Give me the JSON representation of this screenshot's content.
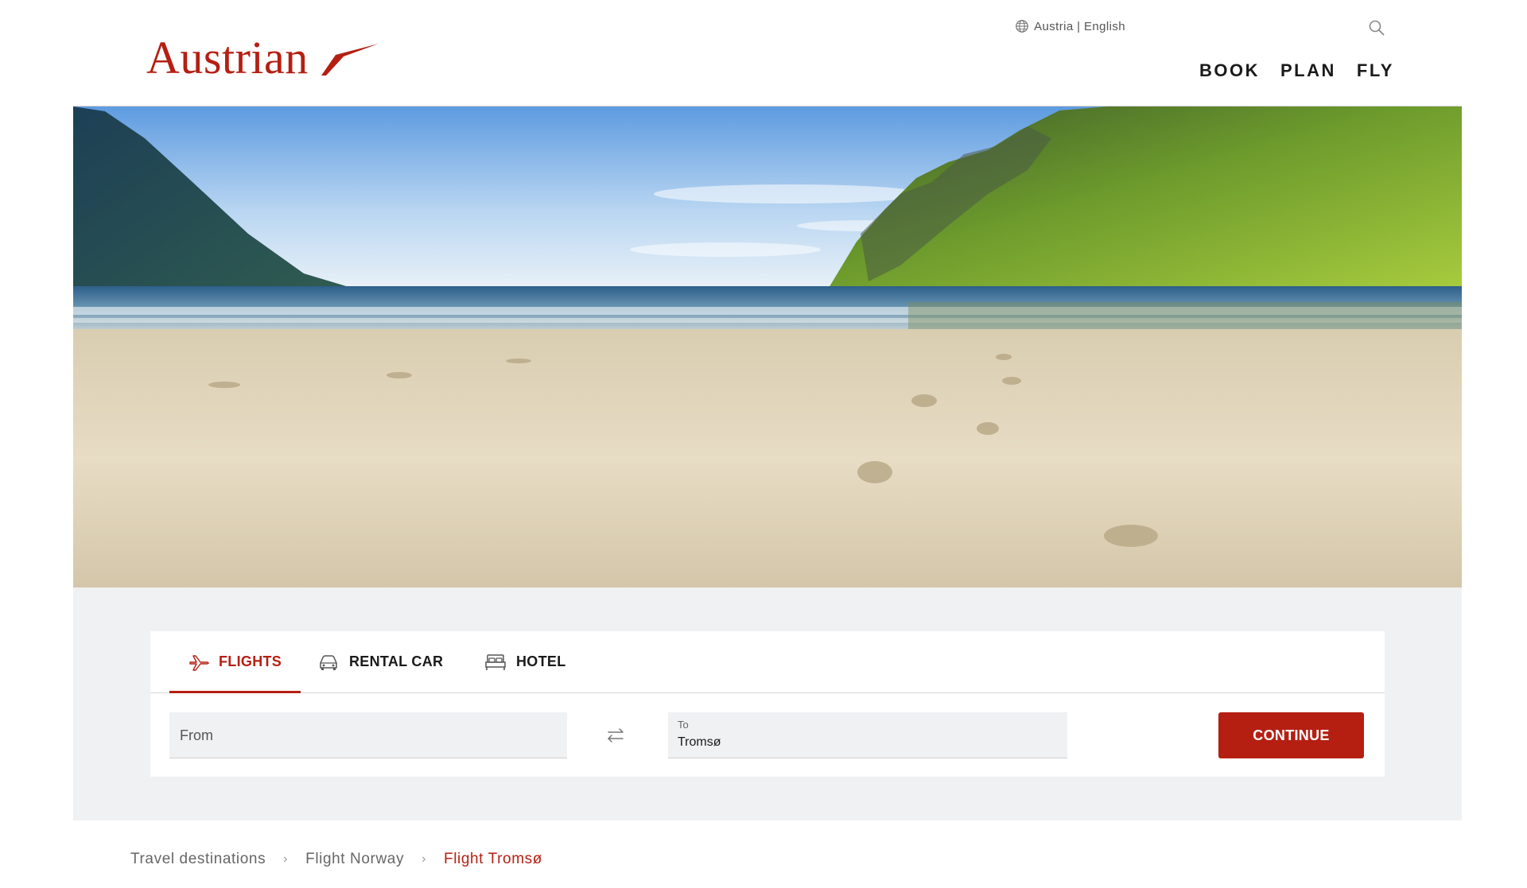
{
  "brand": {
    "name": "Austrian",
    "color": "#b51f12"
  },
  "utility": {
    "locale": "Austria | English",
    "globe_icon": "globe-icon",
    "search_icon": "search-icon"
  },
  "nav": {
    "items": [
      {
        "label": "BOOK"
      },
      {
        "label": "PLAN"
      },
      {
        "label": "FLY"
      }
    ]
  },
  "hero": {
    "image": "beach-landscape-photo"
  },
  "booking": {
    "tabs": [
      {
        "label": "FLIGHTS",
        "icon": "plane-icon",
        "active": true
      },
      {
        "label": "RENTAL CAR",
        "icon": "car-icon",
        "active": false
      },
      {
        "label": "HOTEL",
        "icon": "bed-icon",
        "active": false
      }
    ],
    "from": {
      "placeholder": "From",
      "value": ""
    },
    "to": {
      "label": "To",
      "value": "Tromsø"
    },
    "swap_icon": "swap-arrows-icon",
    "continue_label": "CONTINUE"
  },
  "breadcrumb": {
    "items": [
      {
        "label": "Travel destinations"
      },
      {
        "label": "Flight Norway"
      },
      {
        "label": "Flight Tromsø"
      }
    ],
    "separator": "›"
  }
}
